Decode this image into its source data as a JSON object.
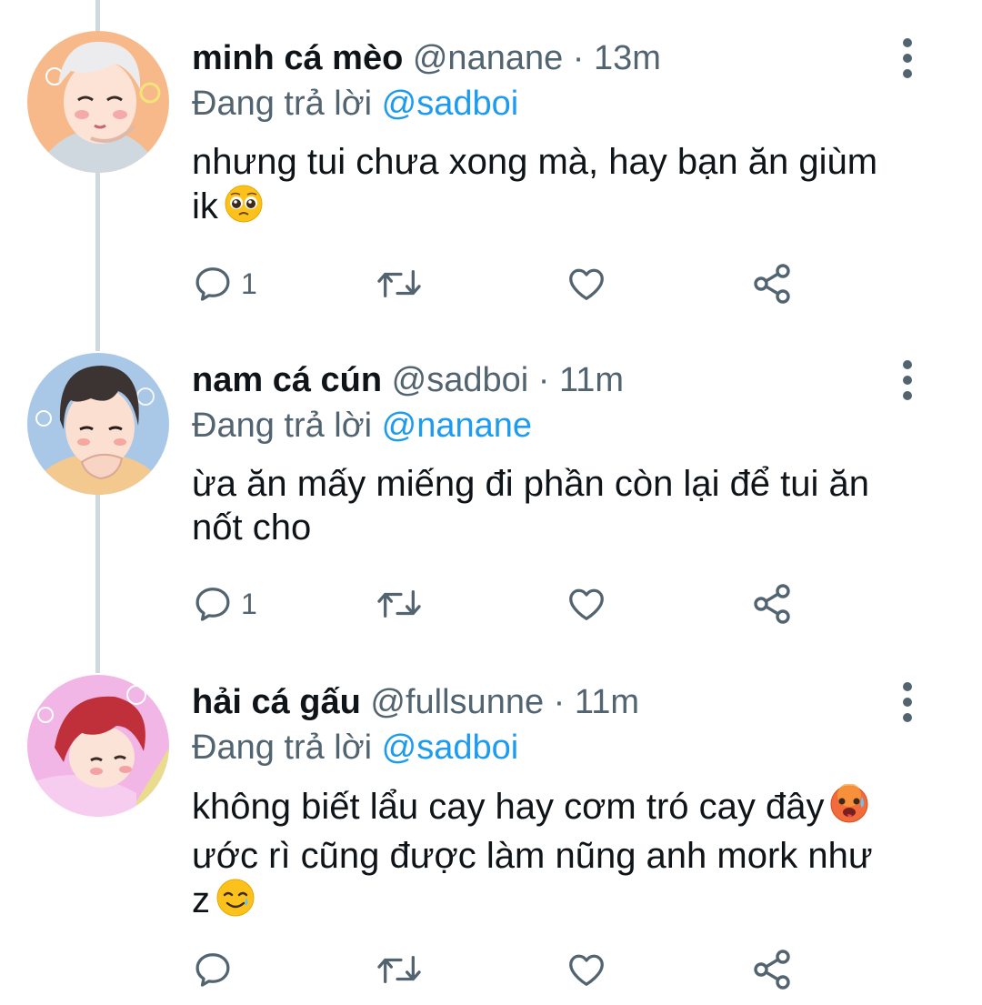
{
  "tweets": [
    {
      "name": "minh cá mèo",
      "handle": "@nanane",
      "dot": " · ",
      "time": "13m",
      "reply_prefix": "Đang trả lời ",
      "reply_to": "@sadboi",
      "text_lines": [
        "nhưng tui chưa xong mà, hay bạn ăn giùm",
        "ik"
      ],
      "emoji": "pleading-face",
      "reply_count": "1",
      "avatar_bg": "#f7b98a"
    },
    {
      "name": "nam cá cún",
      "handle": "@sadboi",
      "dot": " · ",
      "time": "11m",
      "reply_prefix": "Đang trả lời ",
      "reply_to": "@nanane",
      "text_lines": [
        "ừa ăn mấy miếng đi phần còn lại để tui ăn",
        "nốt cho"
      ],
      "reply_count": "1",
      "avatar_bg": "#a9c7e6"
    },
    {
      "name": "hải cá gấu",
      "handle": "@fullsunne",
      "dot": " · ",
      "time": "11m",
      "reply_prefix": "Đang trả lời ",
      "reply_to": "@sadboi",
      "text_lines": [
        "không biết lẩu cay hay cơm tró cay đây",
        "ước rì cũng được làm nũng anh mork như",
        "z"
      ],
      "emojis": [
        "hot-face",
        "smiling-tear-face"
      ],
      "reply_count": "",
      "avatar_bg": "#f2b6e6"
    }
  ],
  "colors": {
    "text": "#0f1419",
    "secondary": "#536471",
    "mention": "#1d9bf0",
    "thread_line": "#cfd9de"
  },
  "icons": [
    "reply-icon",
    "retweet-icon",
    "like-icon",
    "share-icon",
    "more-options-icon"
  ]
}
